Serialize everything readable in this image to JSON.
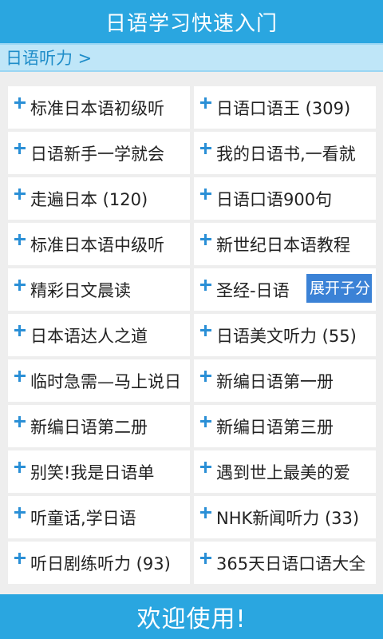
{
  "app": {
    "title": "日语学习快速入门",
    "breadcrumb": "日语听力 >",
    "footer_text": "欢迎使用!"
  },
  "items": [
    "标准日本语初级听",
    "日语口语王 (309)",
    "日语新手一学就会",
    "我的日语书,一看就",
    "走遍日本 (120)",
    "日语口语900句",
    "标准日本语中级听",
    "新世纪日本语教程",
    "精彩日文晨读",
    "圣经-日语",
    "日本语达人之道",
    "日语美文听力 (55)",
    "临时急需—马上说日",
    "新编日语第一册",
    "新编日语第二册",
    "新编日语第三册",
    "别笑!我是日语单",
    "遇到世上最美的爱",
    "听童话,学日语",
    "NHK新闻听力 (33)",
    "听日剧练听力 (93)",
    "365天日语口语大全"
  ],
  "expand_button": "展开子分",
  "colors": {
    "primary": "#2aa6e0",
    "breadcrumb_bg": "#bfe6f8",
    "plus": "#2a8fd6",
    "expand": "#3b82d6"
  },
  "icons": {
    "list_bullet": "plus-icon"
  }
}
